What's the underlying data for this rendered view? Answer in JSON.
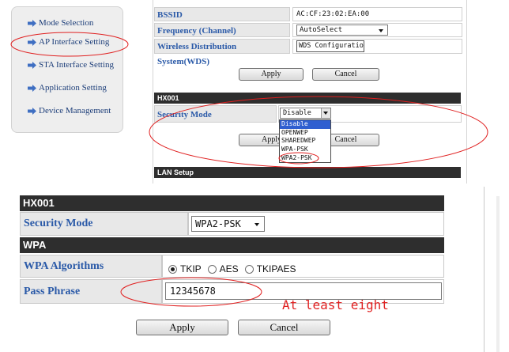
{
  "nav": {
    "items": [
      {
        "label": "Mode Selection"
      },
      {
        "label": "AP Interface Setting"
      },
      {
        "label": "STA Interface Setting"
      },
      {
        "label": "Application Setting"
      },
      {
        "label": "Device Management"
      }
    ]
  },
  "config": {
    "bssid_label": "BSSID",
    "bssid_value": "AC:CF:23:02:EA:00",
    "frequency_label": "Frequency (Channel)",
    "frequency_value": "AutoSelect",
    "wds_label": "Wireless Distribution System(WDS)",
    "wds_button": "WDS Configuration",
    "apply": "Apply",
    "cancel": "Cancel"
  },
  "security_top": {
    "header": "HX001",
    "mode_label": "Security Mode",
    "mode_value": "Disable",
    "options": [
      "Disable",
      "OPENWEP",
      "SHAREDWEP",
      "WPA-PSK",
      "WPA2-PSK"
    ],
    "apply": "Apply",
    "cancel": "Cancel",
    "lan_header": "LAN Setup"
  },
  "security_bottom": {
    "header": "HX001",
    "mode_label": "Security Mode",
    "mode_value": "WPA2-PSK",
    "wpa_header": "WPA",
    "algorithms_label": "WPA Algorithms",
    "algorithms": [
      {
        "label": "TKIP",
        "selected": true
      },
      {
        "label": "AES",
        "selected": false
      },
      {
        "label": "TKIPAES",
        "selected": false
      }
    ],
    "passphrase_label": "Pass Phrase",
    "passphrase_value": "12345678",
    "annotation": "At least eight",
    "apply": "Apply",
    "cancel": "Cancel"
  },
  "colors": {
    "label_text": "#2b5aa8",
    "header_bar": "#2e2e2e",
    "annotation_red": "#e02020"
  }
}
